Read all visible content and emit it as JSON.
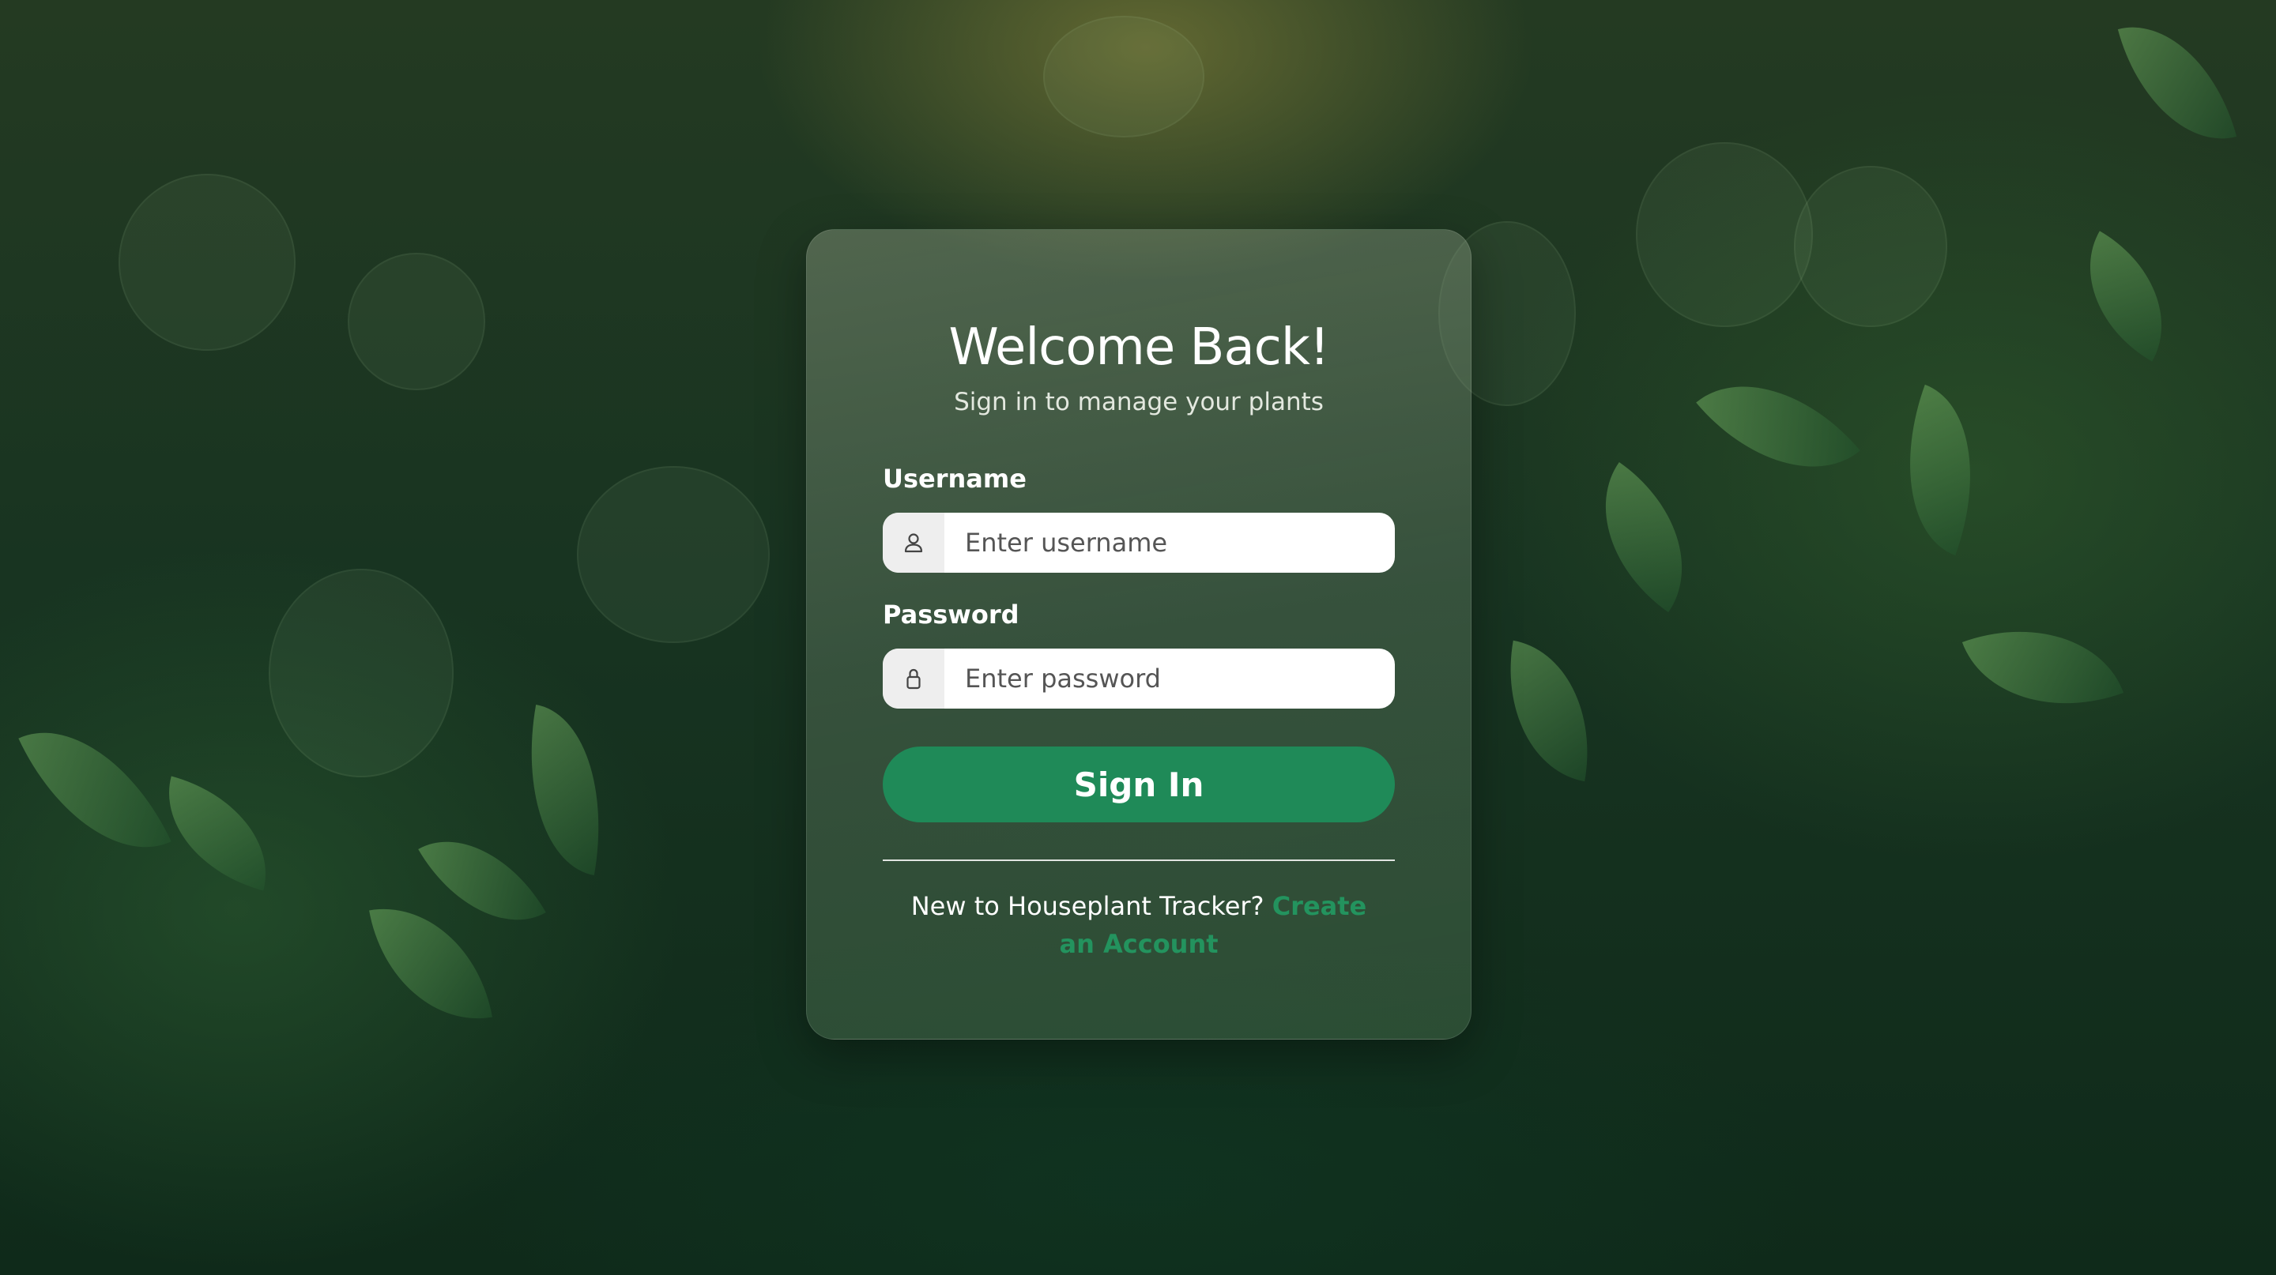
{
  "login": {
    "title": "Welcome Back!",
    "subtitle": "Sign in to manage your plants",
    "username_label": "Username",
    "username_placeholder": "Enter username",
    "username_icon": "user-icon",
    "password_label": "Password",
    "password_placeholder": "Enter password",
    "password_icon": "lock-icon",
    "signin_label": "Sign In",
    "footer_text": "New to Houseplant Tracker?",
    "create_account_label": "Create an Account"
  },
  "colors": {
    "accent": "#1f8a58",
    "link": "#23935e"
  }
}
